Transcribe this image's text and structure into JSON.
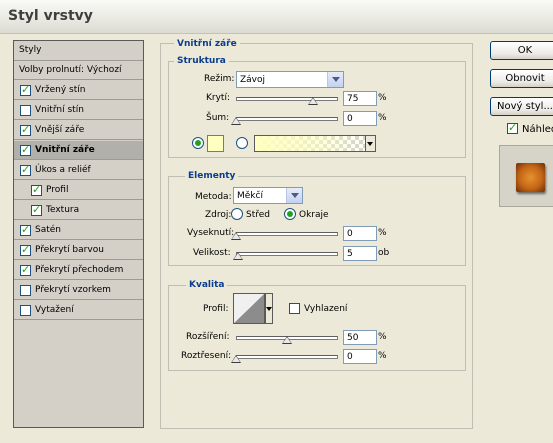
{
  "window": {
    "title": "Styl vrstvy"
  },
  "sidebar": {
    "items": [
      {
        "label": "Styly",
        "type": "plain"
      },
      {
        "label": "Volby prolnutí: Výchozí",
        "type": "plain"
      },
      {
        "label": "Vržený stín",
        "checked": true
      },
      {
        "label": "Vnitřní stín",
        "checked": false
      },
      {
        "label": "Vnější záře",
        "checked": true
      },
      {
        "label": "Vnitřní záře",
        "checked": true,
        "selected": true
      },
      {
        "label": "Úkos a reliéf",
        "checked": true
      },
      {
        "label": "Profil",
        "checked": true,
        "sub": true
      },
      {
        "label": "Textura",
        "checked": true,
        "sub": true
      },
      {
        "label": "Satén",
        "checked": true
      },
      {
        "label": "Překrytí barvou",
        "checked": true
      },
      {
        "label": "Překrytí přechodem",
        "checked": true
      },
      {
        "label": "Překrytí vzorkem",
        "checked": false
      },
      {
        "label": "Vytažení",
        "checked": false
      }
    ]
  },
  "panel": {
    "title": "Vnitřní záře",
    "structure": {
      "title": "Struktura",
      "blend_label": "Režim:",
      "blend_value": "Závoj",
      "opacity_label": "Krytí:",
      "opacity_value": "75",
      "opacity_level": 75,
      "opacity_unit": "%",
      "noise_label": "Šum:",
      "noise_value": "0",
      "noise_level": 0,
      "noise_unit": "%",
      "color_swatch": "#ffffc0",
      "gradient_start": "#ffffc0"
    },
    "elements": {
      "title": "Elementy",
      "method_label": "Metoda:",
      "method_value": "Měkčí",
      "source_label": "Zdroj:",
      "source_center": "Střed",
      "source_edge": "Okraje",
      "choke_label": "Vyseknutí:",
      "choke_value": "0",
      "choke_level": 0,
      "choke_unit": "%",
      "size_label": "Velikost:",
      "size_value": "5",
      "size_level": 2.4,
      "size_unit": "ob"
    },
    "quality": {
      "title": "Kvalita",
      "contour_label": "Profil:",
      "antialias_label": "Vyhlazení",
      "range_label": "Rozšíření:",
      "range_value": "50",
      "range_level": 50,
      "range_unit": "%",
      "jitter_label": "Roztřesení:",
      "jitter_value": "0",
      "jitter_level": 0,
      "jitter_unit": "%"
    }
  },
  "buttons": {
    "ok": "OK",
    "cancel": "Obnovit",
    "new_style": "Nový styl...",
    "preview": "Náhled"
  }
}
